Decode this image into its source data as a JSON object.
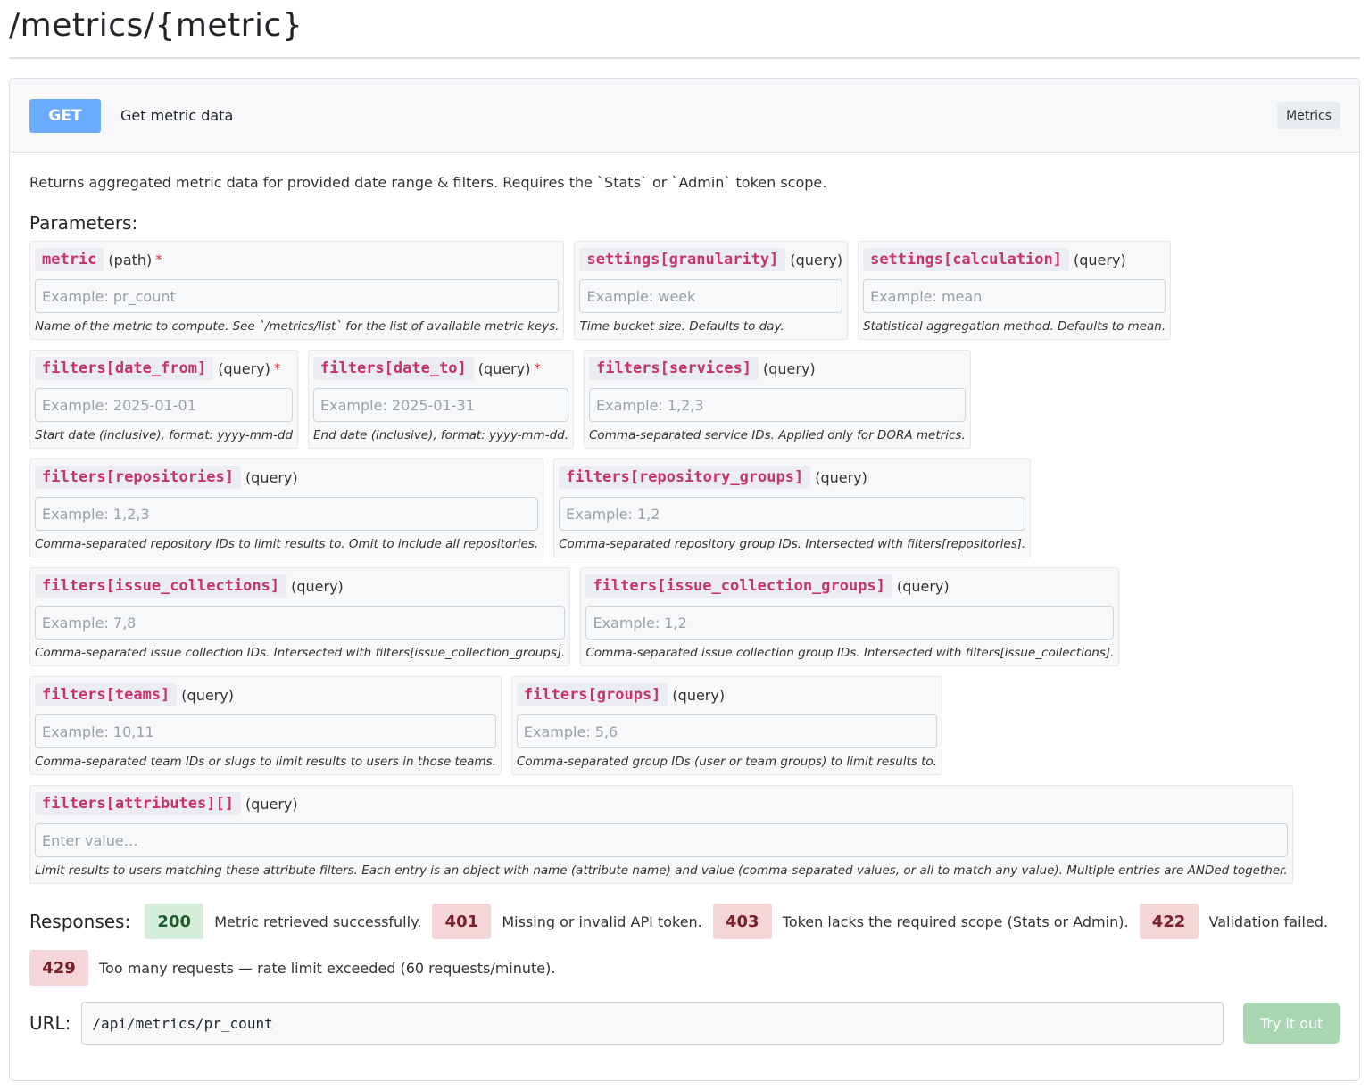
{
  "page": {
    "title": "/metrics/{metric}"
  },
  "endpoint": {
    "method": "GET",
    "summary": "Get metric data",
    "tag": "Metrics",
    "description": "Returns aggregated metric data for provided date range & filters. Requires the `Stats` or `Admin` token scope."
  },
  "parameters_label": "Parameters:",
  "parameters": [
    {
      "name": "metric",
      "in": "(path)",
      "required": "*",
      "placeholder": "Example: pr_count",
      "description": "Name of the metric to compute. See `/metrics/list` for the list of available metric keys."
    },
    {
      "name": "settings[granularity]",
      "in": "(query)",
      "required": "",
      "placeholder": "Example: week",
      "description": "Time bucket size. Defaults to day."
    },
    {
      "name": "settings[calculation]",
      "in": "(query)",
      "required": "",
      "placeholder": "Example: mean",
      "description": "Statistical aggregation method. Defaults to mean."
    },
    {
      "name": "filters[date_from]",
      "in": "(query)",
      "required": "*",
      "placeholder": "Example: 2025-01-01",
      "description": "Start date (inclusive), format: yyyy-mm-dd"
    },
    {
      "name": "filters[date_to]",
      "in": "(query)",
      "required": "*",
      "placeholder": "Example: 2025-01-31",
      "description": "End date (inclusive), format: yyyy-mm-dd."
    },
    {
      "name": "filters[services]",
      "in": "(query)",
      "required": "",
      "placeholder": "Example: 1,2,3",
      "description": "Comma-separated service IDs. Applied only for DORA metrics."
    },
    {
      "name": "filters[repositories]",
      "in": "(query)",
      "required": "",
      "placeholder": "Example: 1,2,3",
      "description": "Comma-separated repository IDs to limit results to. Omit to include all repositories."
    },
    {
      "name": "filters[repository_groups]",
      "in": "(query)",
      "required": "",
      "placeholder": "Example: 1,2",
      "description": "Comma-separated repository group IDs. Intersected with filters[repositories]."
    },
    {
      "name": "filters[issue_collections]",
      "in": "(query)",
      "required": "",
      "placeholder": "Example: 7,8",
      "description": "Comma-separated issue collection IDs. Intersected with filters[issue_collection_groups]."
    },
    {
      "name": "filters[issue_collection_groups]",
      "in": "(query)",
      "required": "",
      "placeholder": "Example: 1,2",
      "description": "Comma-separated issue collection group IDs. Intersected with filters[issue_collections]."
    },
    {
      "name": "filters[teams]",
      "in": "(query)",
      "required": "",
      "placeholder": "Example: 10,11",
      "description": "Comma-separated team IDs or slugs to limit results to users in those teams."
    },
    {
      "name": "filters[groups]",
      "in": "(query)",
      "required": "",
      "placeholder": "Example: 5,6",
      "description": "Comma-separated group IDs (user or team groups) to limit results to."
    },
    {
      "name": "filters[attributes][]",
      "in": "(query)",
      "required": "",
      "placeholder": "Enter value…",
      "description": "Limit results to users matching these attribute filters. Each entry is an object with name (attribute name) and value (comma-separated values, or all to match any value). Multiple entries are ANDed together."
    }
  ],
  "responses_label": "Responses:",
  "responses": [
    {
      "code": "200",
      "text": "Metric retrieved successfully."
    },
    {
      "code": "401",
      "text": "Missing or invalid API token."
    },
    {
      "code": "403",
      "text": "Token lacks the required scope (Stats or Admin)."
    },
    {
      "code": "422",
      "text": "Validation failed."
    },
    {
      "code": "429",
      "text": "Too many requests — rate limit exceeded (60 requests/minute)."
    }
  ],
  "url": {
    "label": "URL:",
    "value": "/api/metrics/pr_count"
  },
  "try_button_label": "Try it out",
  "colors": {
    "method_get": "#6aabfd",
    "param_name": "#c7326f",
    "required_star": "#d63548",
    "response_success_bg": "#d7eddb",
    "response_error_bg": "#f4d6d9",
    "try_button_bg": "#a8d7b2"
  }
}
